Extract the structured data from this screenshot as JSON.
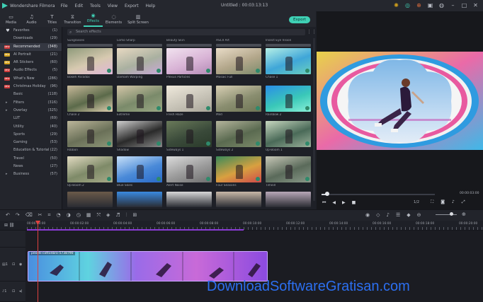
{
  "titlebar": {
    "app_name": "Wondershare Filmora",
    "menu": [
      "File",
      "Edit",
      "Tools",
      "View",
      "Export",
      "Help"
    ],
    "doc_title": "Untitled : 00:03:13:13",
    "icons": [
      "light-bulb-icon",
      "headset-icon",
      "cart-icon",
      "save-icon",
      "notification-icon",
      "minimize-icon",
      "maximize-icon",
      "close-icon"
    ]
  },
  "toolbar": {
    "tabs": [
      {
        "label": "Media",
        "icon": "folder-icon"
      },
      {
        "label": "Audio",
        "icon": "music-note-icon"
      },
      {
        "label": "Titles",
        "icon": "text-t-icon"
      },
      {
        "label": "Transition",
        "icon": "transition-icon"
      },
      {
        "label": "Effects",
        "icon": "effects-icon"
      },
      {
        "label": "Elements",
        "icon": "elements-icon"
      },
      {
        "label": "Split Screen",
        "icon": "split-screen-icon"
      }
    ],
    "active_tab": "Effects",
    "export_label": "Export"
  },
  "sidebar": {
    "items": [
      {
        "label": "Favorites",
        "count": "(1)",
        "icon": "heart-icon"
      },
      {
        "label": "Downloads",
        "count": "(29)"
      },
      {
        "label": "Recommended",
        "count": "(348)",
        "icon": "new-badge-icon",
        "selected": true
      },
      {
        "label": "AI Portrait",
        "count": "(21)",
        "icon": "new-badge-icon"
      },
      {
        "label": "AR Stickers",
        "count": "(60)",
        "icon": "new-badge-icon"
      },
      {
        "label": "Audio Effects",
        "count": "(5)",
        "icon": "new-badge-icon"
      },
      {
        "label": "What's New",
        "count": "(286)",
        "icon": "new-badge-icon"
      },
      {
        "label": "Christmas Holiday",
        "count": "(96)",
        "icon": "new-badge-icon"
      },
      {
        "label": "Basic",
        "count": "(118)"
      },
      {
        "label": "Filters",
        "count": "(316)",
        "caret": true
      },
      {
        "label": "Overlay",
        "count": "(325)",
        "caret": true
      },
      {
        "label": "LUT",
        "count": "(69)"
      },
      {
        "label": "Utility",
        "count": "(40)"
      },
      {
        "label": "Sports",
        "count": "(29)"
      },
      {
        "label": "Gaming",
        "count": "(53)"
      },
      {
        "label": "Education & Tutorial",
        "count": "(22)"
      },
      {
        "label": "Travel",
        "count": "(50)"
      },
      {
        "label": "News",
        "count": "(27)"
      },
      {
        "label": "Business",
        "count": "(57)",
        "caret": true
      }
    ]
  },
  "effects": {
    "search_placeholder": "Search effects",
    "top_labels": [
      "Sunglasses",
      "Lomo Sharp",
      "Beauty Skin",
      "ASCII Art",
      "Insect Eye Vision"
    ],
    "rows": [
      [
        "Bokeh Paradox",
        "Damam Warping",
        "Plexus Particles",
        "Mosaic Full",
        "Chase 1"
      ],
      [
        "Chase 2",
        "Extreme",
        "Fresh Haze",
        "Mild",
        "Rainbow 2"
      ],
      [
        "Ribbon",
        "Shadow",
        "Sideways 1",
        "Sideways 2",
        "Up-Boom 1"
      ],
      [
        "Up-Boom 2",
        "Blue Skies",
        "Alert Noise",
        "Four Seasons",
        "Timeill"
      ]
    ]
  },
  "preview": {
    "timecode": "00:00:03:00",
    "ratio": "1/2",
    "progress": 0.05
  },
  "timeline": {
    "ruler_labels": [
      "00:00:00:00",
      "00:00:02:00",
      "00:00:04:00",
      "00:00:06:00",
      "00:00:08:00",
      "00:00:10:00",
      "00:00:12:00",
      "00:00:14:00",
      "00:00:16:00",
      "00:00:18:00",
      "00:00:20:00"
    ],
    "clip_name": "pexels-cottonbro-5738790"
  },
  "watermark": "DownloadSoftwareGratisan.com",
  "colors": {
    "accent": "#3fd0b5",
    "playhead": "#e0413f",
    "new_badge": "#cf3a3a",
    "clip": "#6f4bd0",
    "watermark": "#2c6ff0"
  }
}
